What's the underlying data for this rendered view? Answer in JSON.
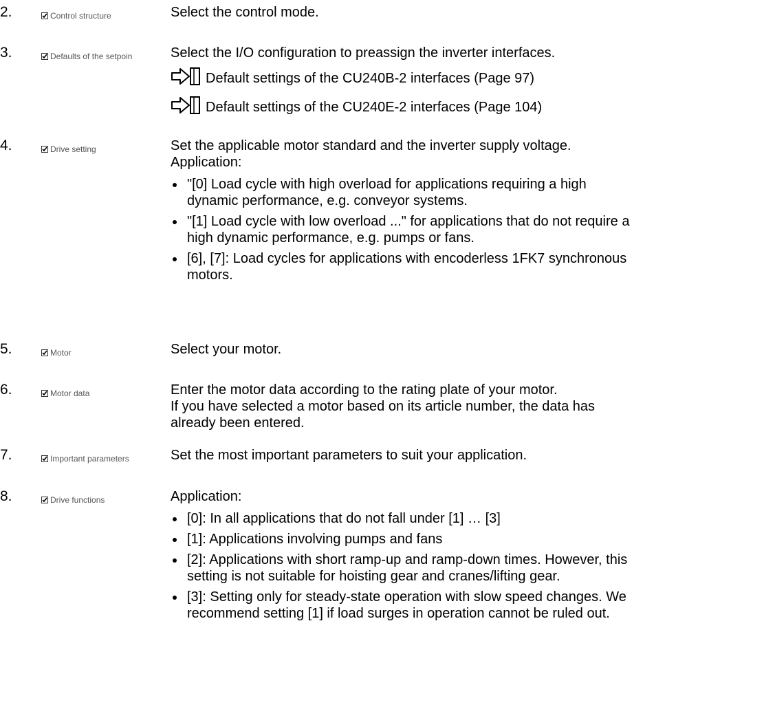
{
  "steps": [
    {
      "num": "2.",
      "checkbox_label": "Control structure",
      "text": "Select the control mode."
    },
    {
      "num": "3.",
      "checkbox_label": "Defaults of the setpoin",
      "text": "Select the I/O configuration to preassign the inverter interfaces.",
      "links": [
        "Default settings of the CU240B-2 interfaces (Page 97)",
        "Default settings of the CU240E-2 interfaces (Page 104)"
      ]
    },
    {
      "num": "4.",
      "checkbox_label": "Drive setting",
      "text": "Set the applicable motor standard and the inverter supply voltage.",
      "sub": "Application:",
      "bullets": [
        "\"[0] Load cycle with high overload for applications requiring a high dynamic performance, e.g. conveyor systems.",
        "\"[1] Load cycle with low overload ...\" for applications that do not require a high dynamic performance, e.g. pumps or fans.",
        "[6], [7]: Load cycles for applications with encoderless 1FK7 synchronous motors."
      ]
    },
    {
      "num": "5.",
      "checkbox_label": "Motor",
      "text": "Select your motor."
    },
    {
      "num": "6.",
      "checkbox_label": "Motor data",
      "text": "Enter the motor data according to the rating plate of your motor.",
      "text2": "If you have selected a motor based on its article number, the data has already been entered."
    },
    {
      "num": "7.",
      "checkbox_label": "Important parameters",
      "text": "Set the most important parameters to suit your application."
    },
    {
      "num": "8.",
      "checkbox_label": "Drive functions",
      "text": "Application:",
      "bullets": [
        "[0]: In all applications that do not fall under [1] … [3]",
        "[1]: Applications involving pumps and fans",
        "[2]: Applications with short ramp-up and ramp-down times. However, this setting is not suitable for hoisting gear and cranes/lifting gear.",
        "[3]: Setting only for steady-state operation with slow speed changes. We recommend setting [1] if load surges in operation cannot be ruled out."
      ]
    }
  ],
  "icons": {
    "checkbox": "checkbox-checked-icon",
    "link": "cross-reference-arrow-icon"
  }
}
